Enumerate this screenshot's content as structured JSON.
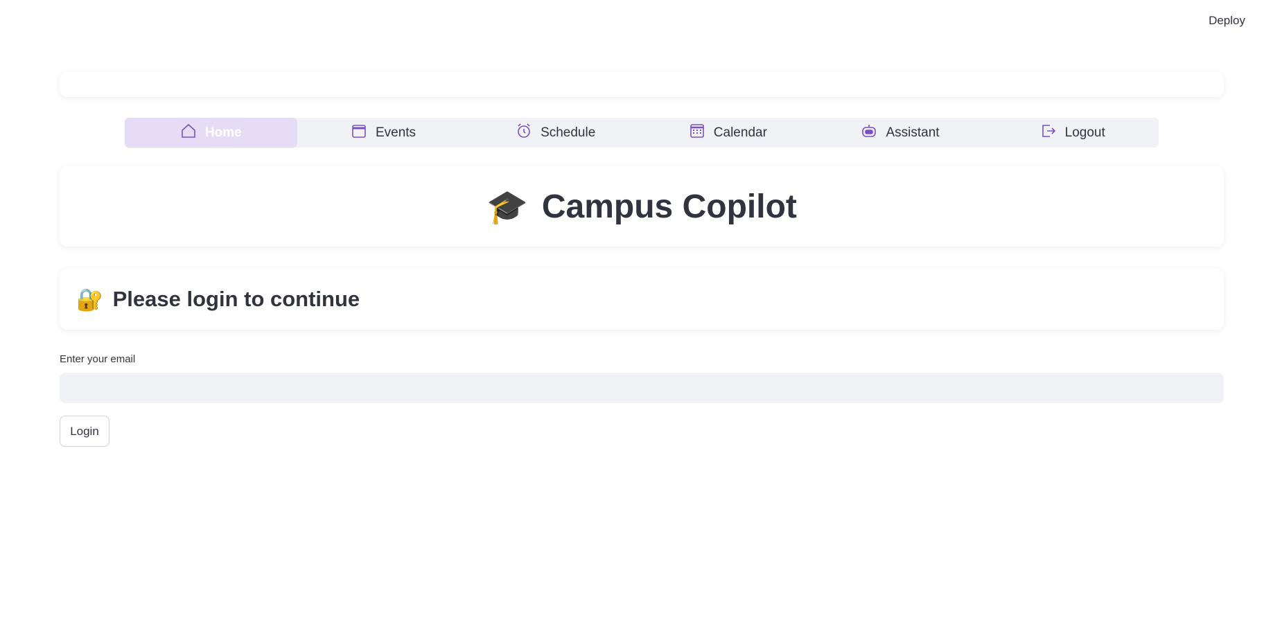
{
  "header": {
    "deploy_label": "Deploy"
  },
  "nav": {
    "items": [
      {
        "label": "Home",
        "icon": "home-icon",
        "active": true
      },
      {
        "label": "Events",
        "icon": "calendar-blank-icon"
      },
      {
        "label": "Schedule",
        "icon": "alarm-clock-icon"
      },
      {
        "label": "Calendar",
        "icon": "calendar-grid-icon"
      },
      {
        "label": "Assistant",
        "icon": "robot-icon"
      },
      {
        "label": "Logout",
        "icon": "logout-icon"
      }
    ]
  },
  "title": {
    "emoji": "🎓",
    "text": "Campus Copilot"
  },
  "login_section": {
    "emoji": "🔐",
    "heading": "Please login to continue"
  },
  "email": {
    "label": "Enter your email",
    "value": "",
    "placeholder": ""
  },
  "login_button": {
    "label": "Login"
  },
  "colors": {
    "accent": "#7b4fc2",
    "active_tab_bg": "#e6dcf5",
    "nav_bg": "#f0f2f6"
  }
}
